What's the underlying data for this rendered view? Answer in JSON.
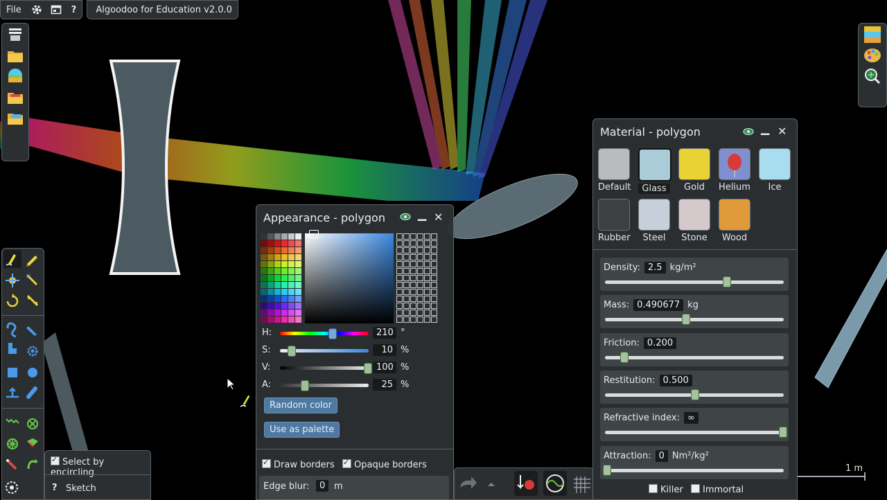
{
  "menubar": {
    "file_label": "File",
    "icons": [
      "gear-icon",
      "window-icon",
      "help-icon"
    ],
    "help_label": "?",
    "app_title": "Algoodoo for Education v2.0.0"
  },
  "appearance": {
    "title": "Appearance - polygon",
    "rows": [
      {
        "label": "H:",
        "value": "210",
        "unit": "°",
        "position": 0.58
      },
      {
        "label": "S:",
        "value": "10",
        "unit": "%",
        "position": 0.1
      },
      {
        "label": "V:",
        "value": "100",
        "unit": "%",
        "position": 1.0
      },
      {
        "label": "A:",
        "value": "25",
        "unit": "%",
        "position": 0.25
      }
    ],
    "random_color_label": "Random color",
    "use_as_palette_label": "Use as palette",
    "draw_borders_label": "Draw borders",
    "opaque_borders_label": "Opaque borders",
    "edge_blur_label": "Edge blur:",
    "edge_blur_value": "0",
    "edge_blur_unit": "m"
  },
  "material": {
    "title": "Material - polygon",
    "presets": [
      {
        "name": "Default",
        "color": "#b9bcbd"
      },
      {
        "name": "Glass",
        "color": "#a9ccd8"
      },
      {
        "name": "Gold",
        "color": "#e9d233"
      },
      {
        "name": "Helium",
        "color": "#7f8fcf"
      },
      {
        "name": "Ice",
        "color": "#a8dcef"
      },
      {
        "name": "Rubber",
        "color": "#3d3f40"
      },
      {
        "name": "Steel",
        "color": "#c7d0da"
      },
      {
        "name": "Stone",
        "color": "#d4c9cb"
      },
      {
        "name": "Wood",
        "color": "#e09a3a"
      }
    ],
    "selected": "Glass",
    "properties": [
      {
        "label": "Density:",
        "value": "2.5",
        "unit": "kg/m²",
        "position": 0.68
      },
      {
        "label": "Mass:",
        "value": "0.490677",
        "unit": "kg",
        "position": 0.45
      },
      {
        "label": "Friction:",
        "value": "0.200",
        "unit": "",
        "position": 0.1
      },
      {
        "label": "Restitution:",
        "value": "0.500",
        "unit": "",
        "position": 0.5
      },
      {
        "label": "Refractive index:",
        "value": "∞",
        "unit": "",
        "position": 1.0
      },
      {
        "label": "Attraction:",
        "value": "0",
        "unit": "Nm²/kg²",
        "position": 0.0
      }
    ],
    "killer_label": "Killer",
    "immortal_label": "Immortal"
  },
  "tool_options": {
    "select_by_encircling_label": "Select by encircling",
    "sketch_label": "Sketch",
    "help_label": "?"
  },
  "scale_label": "1 m",
  "colors": {
    "panel_bg": "#2b2f31",
    "panel_border": "#596064",
    "button_blue": "#4e79a2",
    "slider_knob": "#a3c29d",
    "shape_fill": "#5a6b73",
    "lens_border": "#f0f0f0"
  }
}
